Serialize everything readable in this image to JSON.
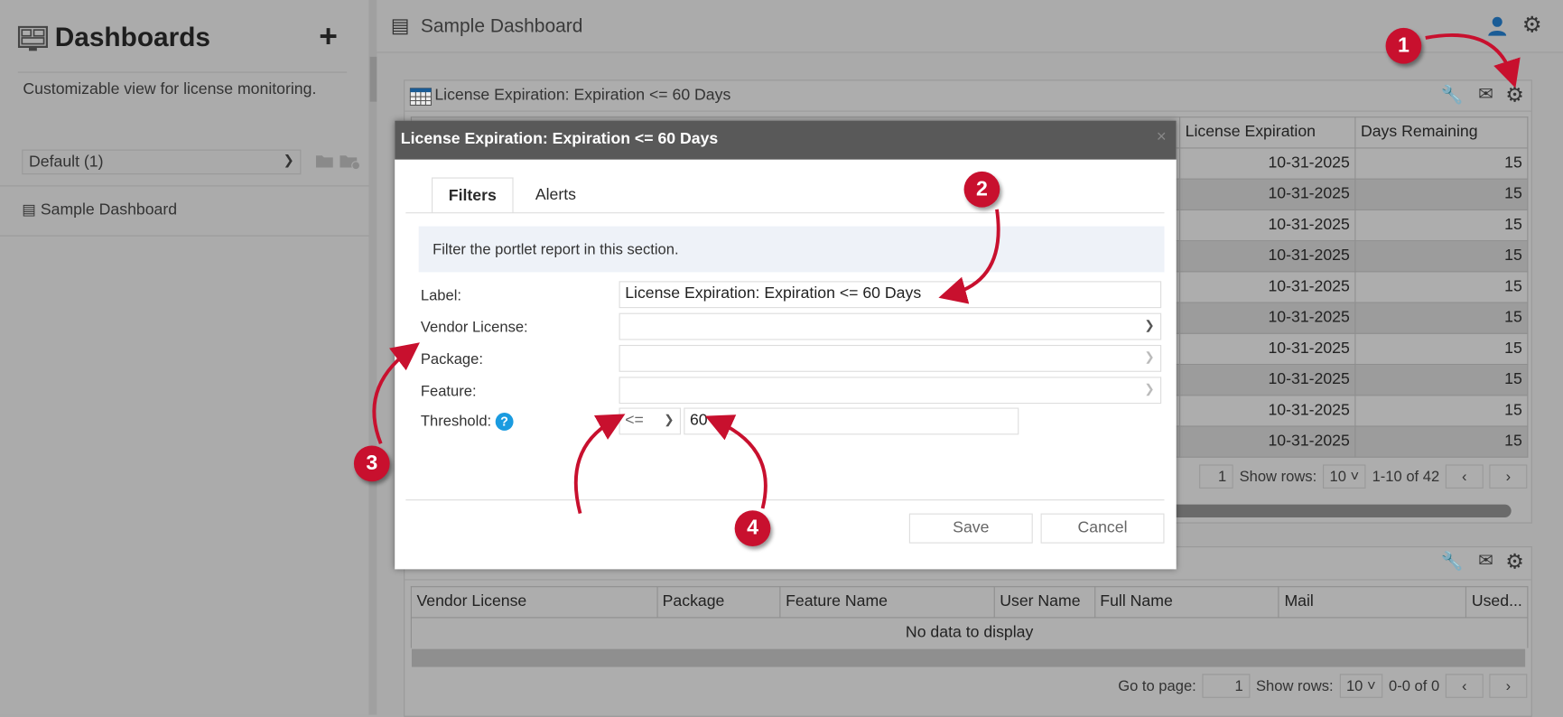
{
  "sidebar": {
    "title": "Dashboards",
    "add_label": "+",
    "description": "Customizable view for license monitoring.",
    "group_select": "Default (1)",
    "items": [
      {
        "label": "Sample Dashboard"
      }
    ]
  },
  "header": {
    "title": "Sample Dashboard"
  },
  "portlet1": {
    "title": "License Expiration: Expiration <= 60 Days",
    "columns": [
      "License Expiration",
      "Days Remaining"
    ],
    "rows": [
      [
        "10-31-2025",
        "15"
      ],
      [
        "10-31-2025",
        "15"
      ],
      [
        "10-31-2025",
        "15"
      ],
      [
        "10-31-2025",
        "15"
      ],
      [
        "10-31-2025",
        "15"
      ],
      [
        "10-31-2025",
        "15"
      ],
      [
        "10-31-2025",
        "15"
      ],
      [
        "10-31-2025",
        "15"
      ],
      [
        "10-31-2025",
        "15"
      ],
      [
        "10-31-2025",
        "15"
      ]
    ],
    "pager": {
      "page": "1",
      "show_rows_label": "Show rows:",
      "rows": "10",
      "range": "1-10 of 42",
      "prev": "‹",
      "next": "›"
    }
  },
  "portlet2": {
    "columns": [
      "Vendor License",
      "Package",
      "Feature Name",
      "User Name",
      "Full Name",
      "Mail",
      "Used..."
    ],
    "empty": "No data to display",
    "pager": {
      "goto_label": "Go to page:",
      "page": "1",
      "show_rows_label": "Show rows:",
      "rows": "10",
      "range": "0-0 of 0",
      "prev": "‹",
      "next": "›"
    }
  },
  "dialog": {
    "title": "License Expiration: Expiration <= 60 Days",
    "close": "×",
    "tabs": [
      "Filters",
      "Alerts"
    ],
    "info": "Filter the portlet report in this section.",
    "fields": {
      "label_label": "Label:",
      "label_value": "License Expiration: Expiration <= 60 Days",
      "vendor_label": "Vendor License:",
      "package_label": "Package:",
      "feature_label": "Feature:",
      "threshold_label": "Threshold:",
      "threshold_op": "<=",
      "threshold_value": "60",
      "help": "?"
    },
    "save": "Save",
    "cancel": "Cancel"
  },
  "annotations": [
    "1",
    "2",
    "3",
    "4"
  ],
  "colors": {
    "annotation": "#c8102e",
    "dialog_header": "#595959",
    "help": "#1a9be0"
  }
}
